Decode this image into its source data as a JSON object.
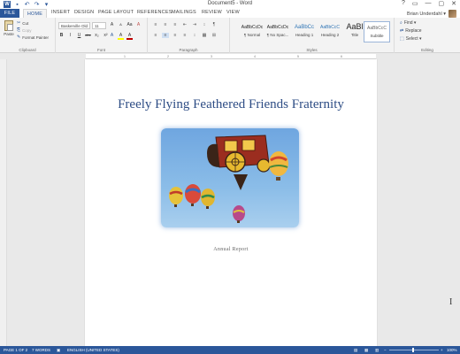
{
  "window": {
    "title": "Document5 - Word",
    "controls": [
      "?",
      "▭",
      "—",
      "▢",
      "✕"
    ]
  },
  "tabs": [
    "FILE",
    "HOME",
    "INSERT",
    "DESIGN",
    "PAGE LAYOUT",
    "REFERENCES",
    "MAILINGS",
    "REVIEW",
    "VIEW"
  ],
  "user": {
    "name": "Brian Underdahl ▾"
  },
  "ribbon": {
    "clipboard": {
      "label": "Clipboard",
      "paste": "Paste",
      "cut": "Cut",
      "copy": "Copy",
      "format_painter": "Format Painter"
    },
    "font": {
      "label": "Font",
      "name": "Baskerville Old",
      "size": "11",
      "row1": [
        "A",
        "A",
        "Aa",
        "A"
      ],
      "row2": [
        "B",
        "I",
        "U",
        "abc",
        "x₂",
        "x²"
      ],
      "row3": [
        "A",
        "A",
        "A"
      ]
    },
    "paragraph": {
      "label": "Paragraph",
      "row1": [
        "≡",
        "≡",
        "≡",
        "⇤",
        "⇥",
        "↕",
        "¶"
      ],
      "row2": [
        "≡",
        "≡",
        "≡",
        "≡",
        "↕",
        "▦",
        "⊞"
      ]
    },
    "styles": {
      "label": "Styles",
      "items": [
        {
          "sample": "AaBbCcDc",
          "name": "¶ Normal"
        },
        {
          "sample": "AaBbCcDc",
          "name": "¶ No Spac..."
        },
        {
          "sample": "AaBbCc",
          "name": "Heading 1"
        },
        {
          "sample": "AaBbCcC",
          "name": "Heading 2"
        },
        {
          "sample": "AaBl",
          "name": "Title"
        },
        {
          "sample": "AaBbCcC",
          "name": "Subtitle"
        }
      ]
    },
    "editing": {
      "label": "Editing",
      "find": "Find ▾",
      "replace": "Replace",
      "select": "Select ▾"
    }
  },
  "ruler_ticks": [
    "1",
    "2",
    "3",
    "4",
    "5",
    "6"
  ],
  "document": {
    "heading": "Freely Flying Feathered Friends Fraternity",
    "subtitle": "Annual Report"
  },
  "statusbar": {
    "page": "PAGE 1 OF 2",
    "words": "7 WORDS",
    "language": "ENGLISH (UNITED STATES)",
    "zoom": "100%"
  },
  "colors": {
    "accent": "#2b579a",
    "heading": "#2e4d85"
  }
}
